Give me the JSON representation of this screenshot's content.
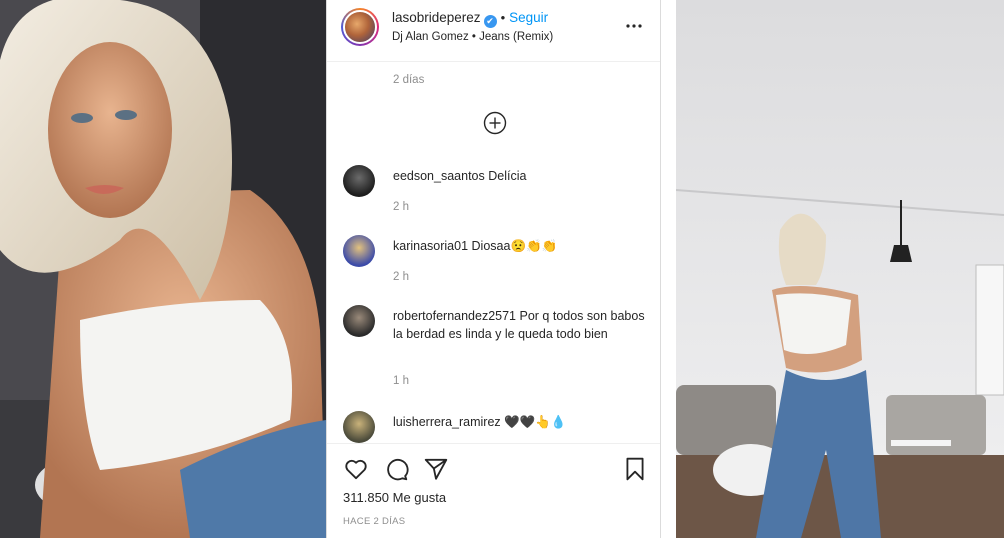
{
  "post": {
    "username": "lasobrideperez",
    "verified_mark": "✔",
    "separator": "•",
    "follow_label": "Seguir",
    "song": "Dj Alan Gomez • Jeans (Remix)",
    "caption_time": "2 días",
    "likes": "311.850 Me gusta",
    "posted_ago": "HACE 2 DÍAS"
  },
  "comments": [
    {
      "user": "eedson_saantos",
      "text": "Delícia",
      "time": "2 h"
    },
    {
      "user": "karinasoria01",
      "text": "Diosaa😟👏👏",
      "time": "2 h"
    },
    {
      "user": "robertofernandez2571",
      "text": "Por q todos son babos la berdad es linda y le queda todo bien",
      "time": "1 h"
    },
    {
      "user": "luisherrera_ramirez",
      "text": "🖤🖤👆💧",
      "time": ""
    }
  ],
  "icons": {
    "more": "more-horizontal-icon",
    "load_more": "plus-circle-icon",
    "like": "heart-icon",
    "comment": "comment-bubble-icon",
    "share": "paper-plane-icon",
    "save": "bookmark-icon"
  },
  "colors": {
    "link": "#0095f6",
    "verified": "#3897f0",
    "text": "#262626",
    "muted": "#8e8e8e"
  }
}
